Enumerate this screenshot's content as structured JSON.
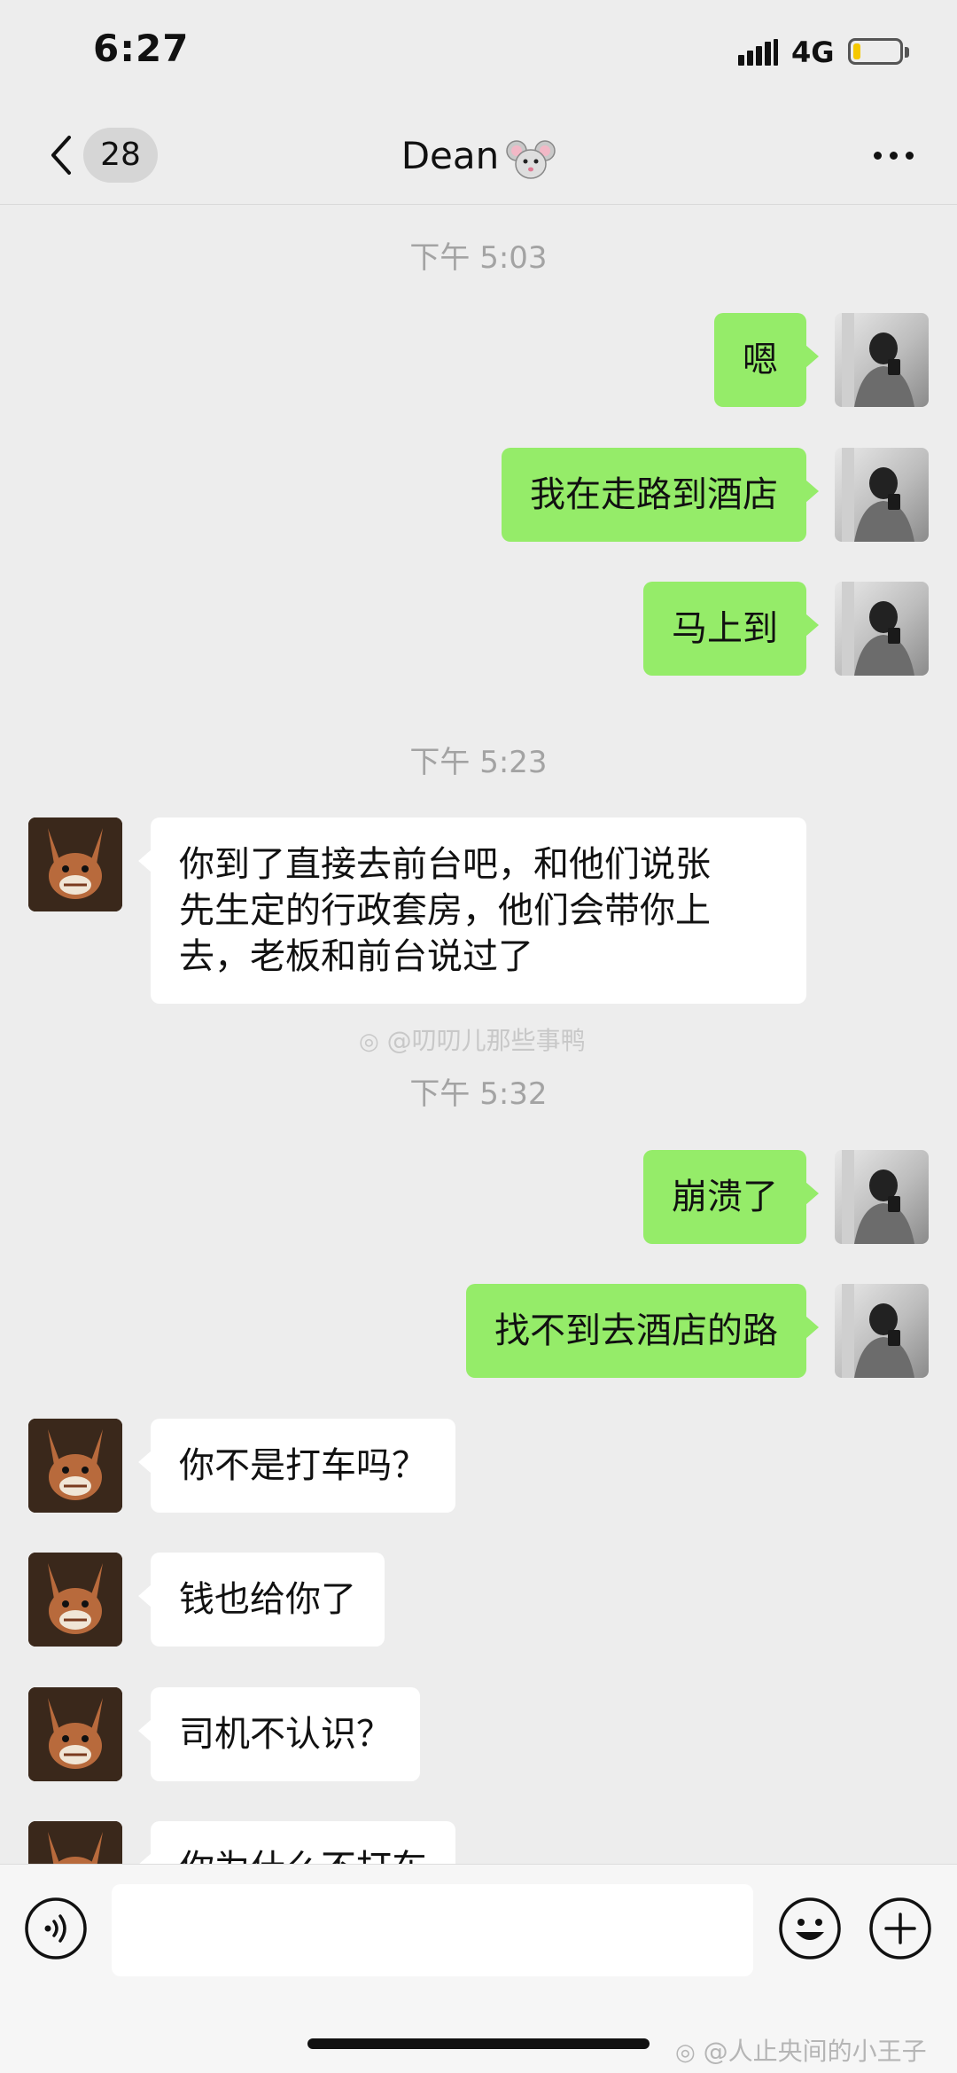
{
  "status_bar": {
    "time": "6:27",
    "network": "4G",
    "battery_level": 0.15
  },
  "nav": {
    "unread_count": "28",
    "title": "Dean",
    "title_emoji": "mouse-face-icon"
  },
  "timestamps": [
    "下午 5:03",
    "下午 5:23",
    "下午 5:32"
  ],
  "messages": [
    {
      "sender": "me",
      "text": "嗯"
    },
    {
      "sender": "me",
      "text": "我在走路到酒店"
    },
    {
      "sender": "me",
      "text": "马上到"
    },
    {
      "sender": "dean",
      "lines": [
        "你到了直接去前台吧，和他们说张",
        "先生定的行政套房，他们会带你上",
        "去，老板和前台说过了"
      ]
    },
    {
      "sender": "me",
      "text": "崩溃了"
    },
    {
      "sender": "me",
      "text": "找不到去酒店的路"
    },
    {
      "sender": "dean",
      "text": "你不是打车吗？"
    },
    {
      "sender": "dean",
      "text": "钱也给你了"
    },
    {
      "sender": "dean",
      "text": "司机不认识？"
    },
    {
      "sender": "dean",
      "text": "你为什么不打车"
    }
  ],
  "watermarks": {
    "middle": "@叨叨儿那些事鸭",
    "bottom": "@人止央间的小王子"
  },
  "input": {
    "value": "",
    "placeholder": ""
  },
  "colors": {
    "background": "#ededed",
    "outgoing_bubble": "#95ec69",
    "incoming_bubble": "#ffffff",
    "timestamp": "#a3a3a3"
  }
}
